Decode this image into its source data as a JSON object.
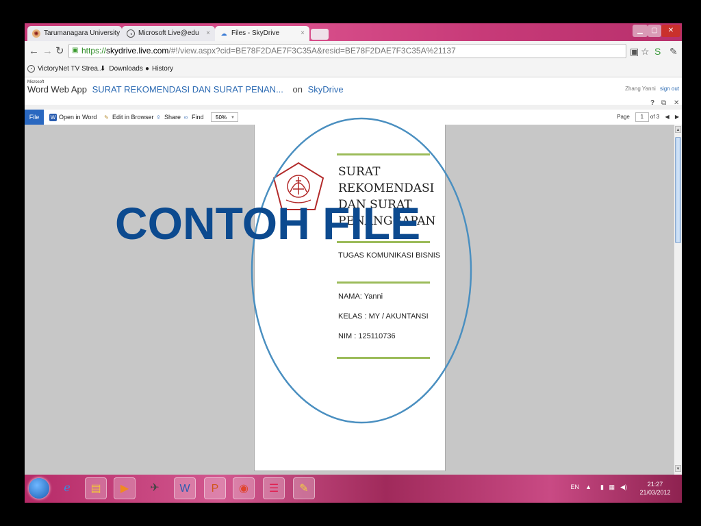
{
  "browser": {
    "tabs": [
      {
        "label": "Tarumanagara University",
        "icon": "university-seal-icon"
      },
      {
        "label": "Microsoft Live@edu",
        "icon": "live-icon"
      },
      {
        "label": "Files - SkyDrive",
        "icon": "skydrive-icon",
        "active": true
      }
    ],
    "tab_close": "×",
    "url_scheme": "https://",
    "url_host": "skydrive.live.com",
    "url_rest": "/#!/view.aspx?cid=BE78F2DAE7F3C35A&resid=BE78F2DAE7F3C35A%21137",
    "bookmarks": [
      {
        "label": "VictoryNet TV Strea..."
      },
      {
        "label": "Downloads"
      },
      {
        "label": "History"
      }
    ]
  },
  "app": {
    "ms_label": "Microsoft",
    "product": "Word Web App",
    "doc_title": "SURAT REKOMENDASI DAN SURAT PENAN...",
    "on_label": "on",
    "location": "SkyDrive",
    "user": "Zhang Yanni",
    "sign_out": "sign out",
    "help": "?",
    "popout": "⧉",
    "close": "✕"
  },
  "ribbon": {
    "file": "File",
    "open_in_word": "Open in Word",
    "edit_in_browser": "Edit in Browser",
    "share": "Share",
    "find": "Find",
    "zoom": "50%",
    "page_label": "Page",
    "page_current": "1",
    "page_of": "of 3"
  },
  "document": {
    "title": "SURAT REKOMENDASI DAN SURAT PENANGGAPAN",
    "subtitle": "TUGAS KOMUNIKASI BISNIS",
    "name": "NAMA: Yanni",
    "kelas": "KELAS : MY / AKUNTANSI",
    "nim": "NIM : 125110736",
    "accent_color": "#9bbb59"
  },
  "taskbar": {
    "language": "EN",
    "time": "21:27",
    "date": "21/03/2012"
  },
  "overlay": {
    "text": "CONTOH FILE",
    "color": "#0c4a8f",
    "circle_color": "#4a8fc0"
  }
}
